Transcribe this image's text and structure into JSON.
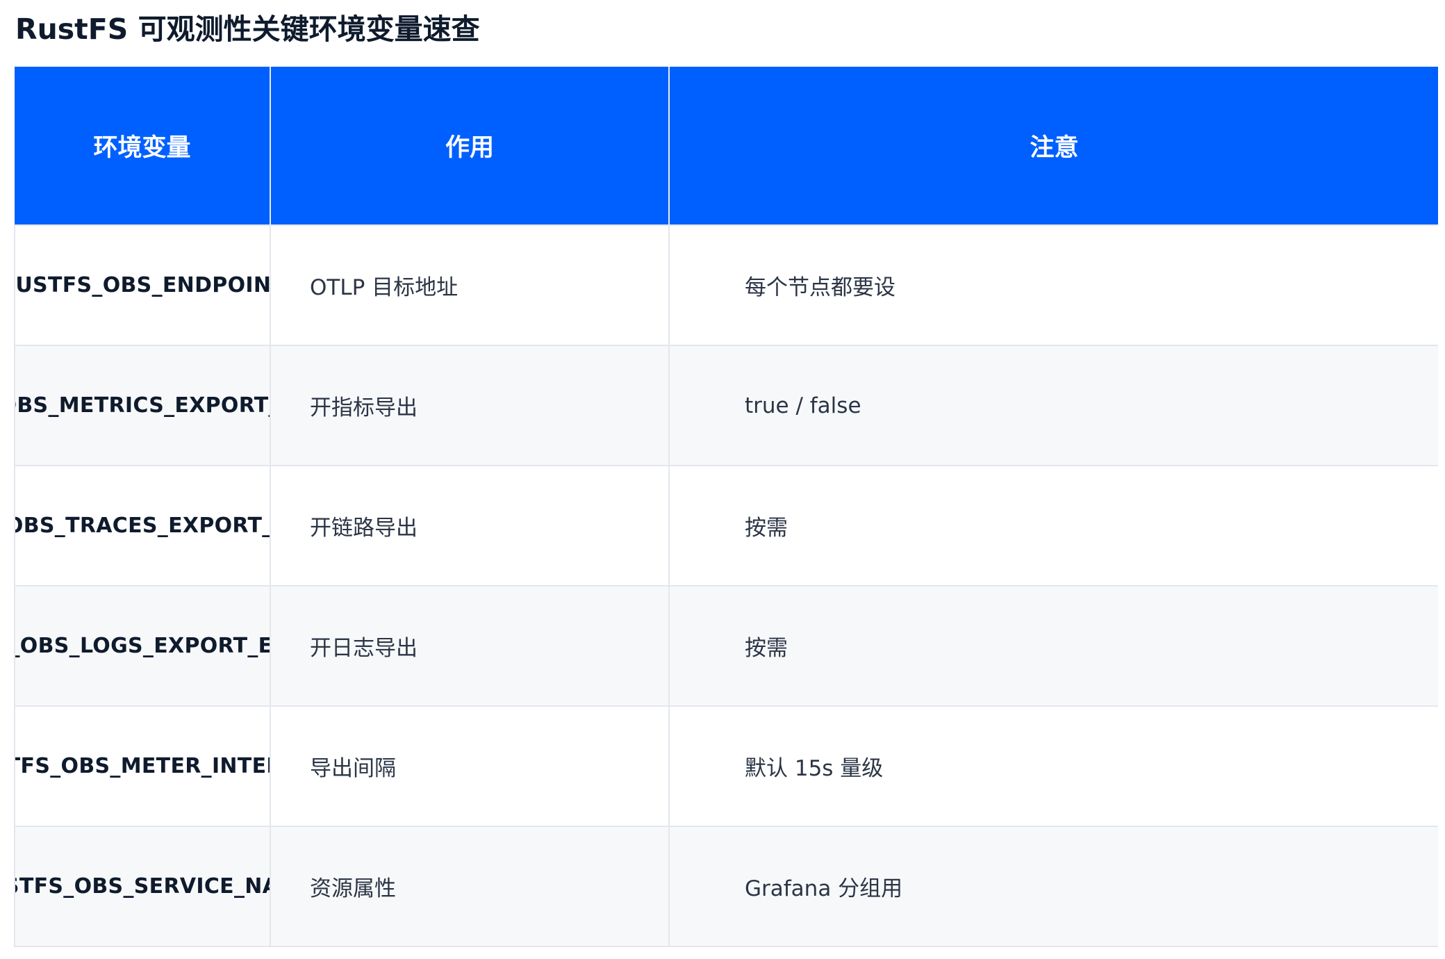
{
  "title": "RustFS 可观测性关键环境变量速查",
  "table": {
    "headers": [
      "环境变量",
      "作用",
      "注意"
    ],
    "rows": [
      {
        "var": "RUSTFS_OBS_ENDPOINT",
        "use": "OTLP 目标地址",
        "note": "每个节点都要设"
      },
      {
        "var": "RUSTFS_OBS_METRICS_EXPORT_ENABLED",
        "use": "开指标导出",
        "note": "true / false"
      },
      {
        "var": "RUSTFS_OBS_TRACES_EXPORT_ENABLED",
        "use": "开链路导出",
        "note": "按需"
      },
      {
        "var": "RUSTFS_OBS_LOGS_EXPORT_ENABLED",
        "use": "开日志导出",
        "note": "按需"
      },
      {
        "var": "RUSTFS_OBS_METER_INTERVAL",
        "use": "导出间隔",
        "note": "默认 15s 量级"
      },
      {
        "var": "RUSTFS_OBS_SERVICE_NAME",
        "use": "资源属性",
        "note": "Grafana 分组用"
      }
    ]
  },
  "colors": {
    "header_bg": "#0060ff",
    "header_text": "#ffffff",
    "row_alt_bg": "#f7f8fa",
    "border": "#e3e7ed"
  }
}
